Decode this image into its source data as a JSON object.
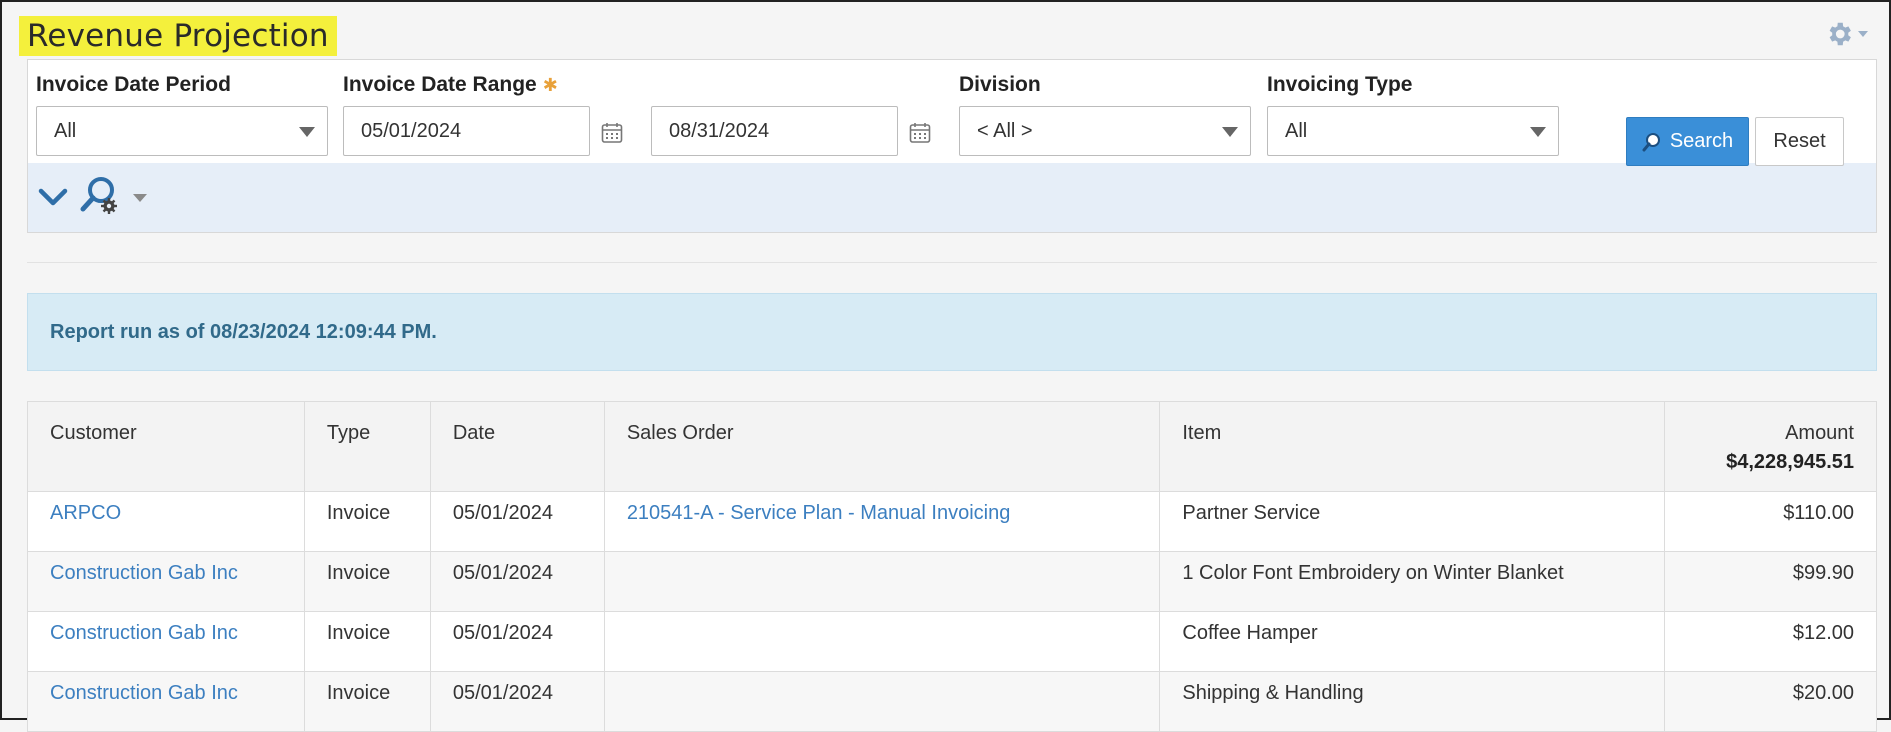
{
  "header": {
    "title": "Revenue Projection",
    "gear_icon": "gear-icon"
  },
  "filters": {
    "invoice_date_period": {
      "label": "Invoice Date Period",
      "value": "All"
    },
    "invoice_date_range": {
      "label": "Invoice Date Range",
      "required_mark": "✱",
      "from": "05/01/2024",
      "to": "08/31/2024"
    },
    "division": {
      "label": "Division",
      "value": "< All >"
    },
    "invoicing_type": {
      "label": "Invoicing Type",
      "value": "All"
    }
  },
  "toolbar": {
    "search_label": "Search",
    "reset_label": "Reset"
  },
  "banner": {
    "text": "Report run as of 08/23/2024 12:09:44 PM."
  },
  "table": {
    "columns": {
      "customer": "Customer",
      "type": "Type",
      "date": "Date",
      "sales_order": "Sales Order",
      "item": "Item",
      "amount": "Amount"
    },
    "amount_total": "$4,228,945.51",
    "rows": [
      {
        "customer": "ARPCO",
        "type": "Invoice",
        "date": "05/01/2024",
        "sales_order": "210541-A - Service Plan - Manual Invoicing",
        "item": "Partner Service",
        "amount": "$110.00"
      },
      {
        "customer": "Construction Gab Inc",
        "type": "Invoice",
        "date": "05/01/2024",
        "sales_order": "",
        "item": "1 Color Font Embroidery on Winter Blanket",
        "amount": "$99.90"
      },
      {
        "customer": "Construction Gab Inc",
        "type": "Invoice",
        "date": "05/01/2024",
        "sales_order": "",
        "item": "Coffee Hamper",
        "amount": "$12.00"
      },
      {
        "customer": "Construction Gab Inc",
        "type": "Invoice",
        "date": "05/01/2024",
        "sales_order": "",
        "item": "Shipping & Handling",
        "amount": "$20.00"
      }
    ]
  },
  "colors": {
    "accent": "#3a8fd8",
    "highlight": "#f4f03c",
    "banner_bg": "#d7ebf5",
    "link": "#3c7fc0"
  }
}
